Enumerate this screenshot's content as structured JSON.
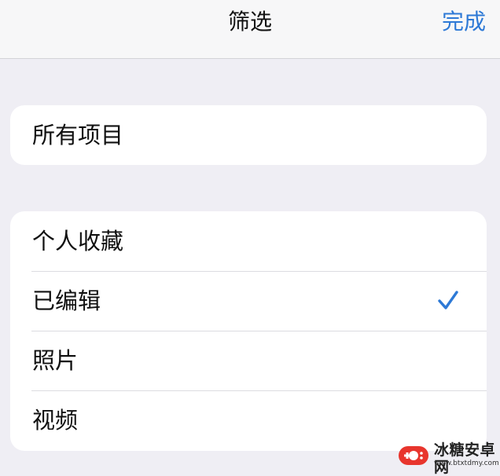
{
  "navbar": {
    "title": "筛选",
    "done_label": "完成"
  },
  "all_items": {
    "label": "所有项目"
  },
  "filters": {
    "items": [
      {
        "label": "个人收藏",
        "selected": false
      },
      {
        "label": "已编辑",
        "selected": true
      },
      {
        "label": "照片",
        "selected": false
      },
      {
        "label": "视频",
        "selected": false
      }
    ]
  },
  "watermark": {
    "name": "冰糖安卓网",
    "url": "www.btxtdmy.com"
  },
  "colors": {
    "accent": "#2d79d6",
    "background": "#efeef4",
    "card": "#ffffff",
    "brand_red": "#e8352d"
  },
  "icons": {
    "checkmark": "check-icon",
    "logo": "gamepad-logo-icon"
  }
}
